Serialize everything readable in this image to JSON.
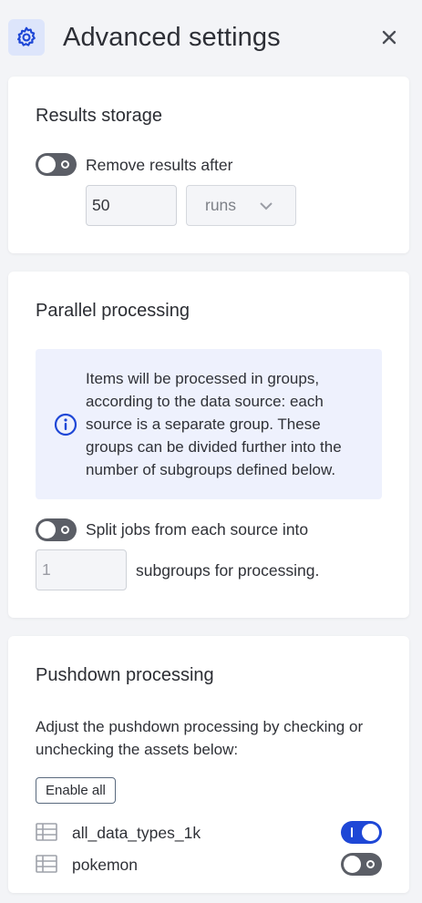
{
  "header": {
    "title": "Advanced settings"
  },
  "results_storage": {
    "title": "Results storage",
    "toggle_label": "Remove results after",
    "toggle_on": false,
    "count_value": "50",
    "unit_selected": "runs"
  },
  "parallel": {
    "title": "Parallel processing",
    "info_text": "Items will be processed in groups, according to the data source: each source is a separate group. These groups can be divided further into the number of subgroups defined below.",
    "toggle_label": "Split jobs from each source into",
    "toggle_on": false,
    "subgroups_value": "1",
    "subgroups_suffix": "subgroups for processing."
  },
  "pushdown": {
    "title": "Pushdown processing",
    "description": "Adjust the pushdown processing by checking or unchecking the assets below:",
    "enable_all_label": "Enable all",
    "assets": [
      {
        "name": "all_data_types_1k",
        "enabled": true
      },
      {
        "name": "pokemon",
        "enabled": false
      }
    ]
  },
  "colors": {
    "accent": "#1e47d6",
    "toggle_off": "#5b5e66",
    "info_bg": "#eef1fd"
  }
}
